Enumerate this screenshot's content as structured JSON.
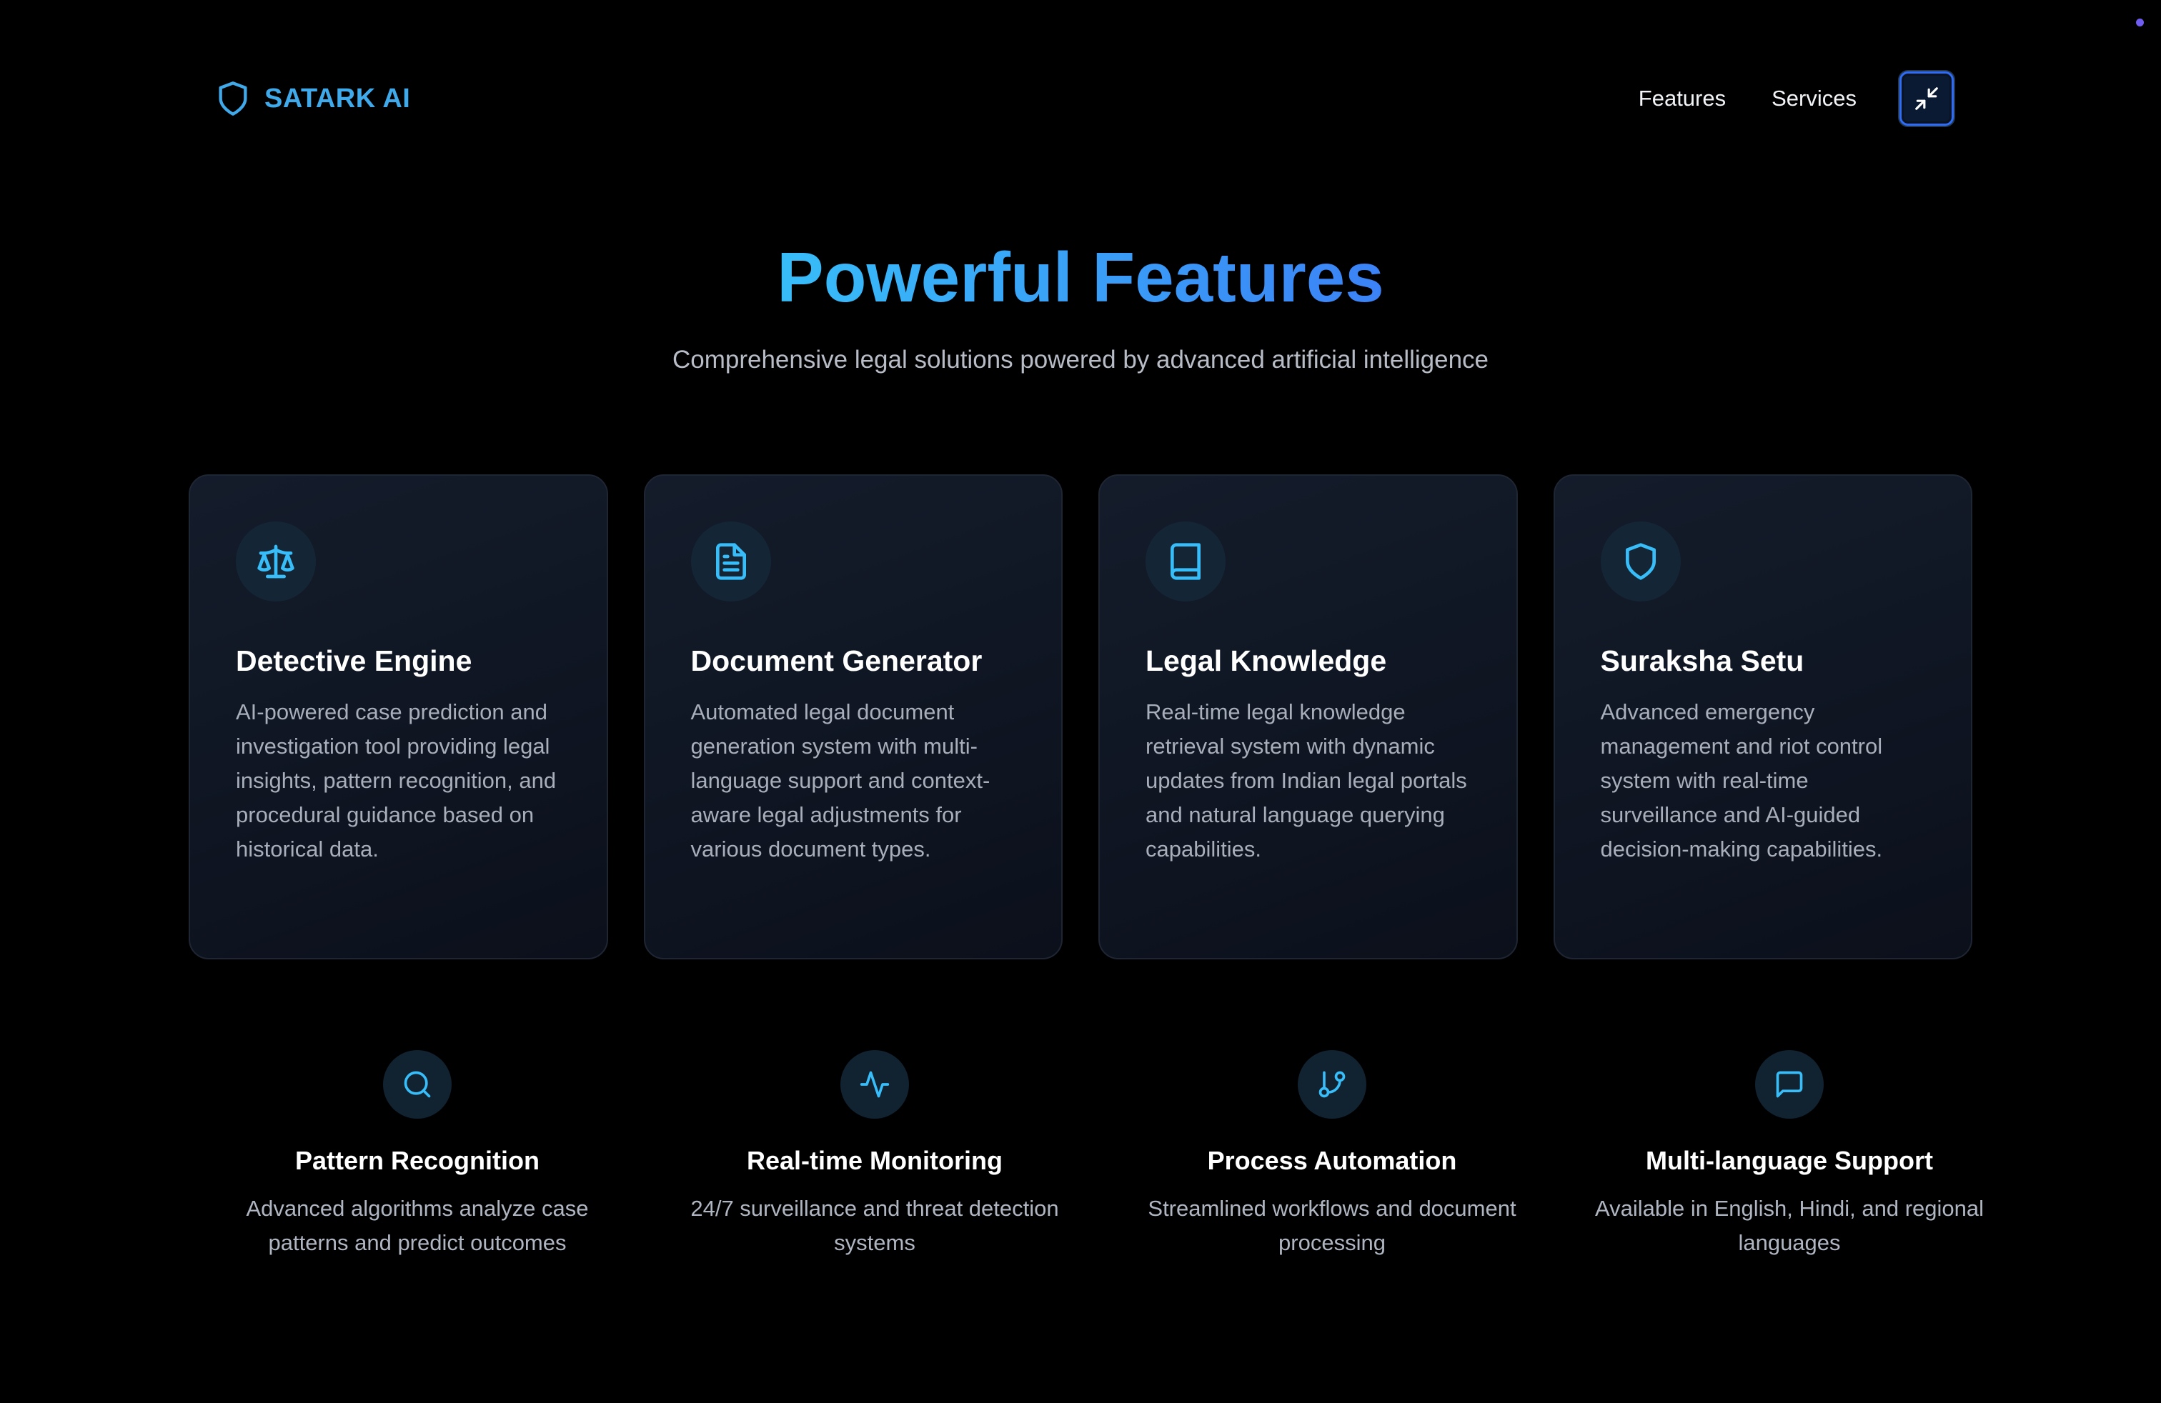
{
  "colors": {
    "background": "#000000",
    "accent": "#3fa9ea",
    "accent_gradient_start": "#38bdf8",
    "accent_gradient_end": "#3b82f6",
    "card_bg": "#0f1522",
    "card_border": "#1f2633",
    "icon_circle": "#142636"
  },
  "header": {
    "brand_icon": "shield-icon",
    "brand_name": "SATARK AI",
    "nav": [
      {
        "label": "Features"
      },
      {
        "label": "Services"
      }
    ],
    "action_icon": "minimize-icon"
  },
  "hero": {
    "title": "Powerful Features",
    "subtitle": "Comprehensive legal solutions powered by advanced artificial intelligence"
  },
  "cards": [
    {
      "icon": "scale-icon",
      "title": "Detective Engine",
      "description": "AI-powered case prediction and investigation tool providing legal insights, pattern recognition, and procedural guidance based on historical data."
    },
    {
      "icon": "document-icon",
      "title": "Document Generator",
      "description": "Automated legal document generation system with multi-language support and context-aware legal adjustments for various document types."
    },
    {
      "icon": "book-icon",
      "title": "Legal Knowledge",
      "description": "Real-time legal knowledge retrieval system with dynamic updates from Indian legal portals and natural language querying capabilities."
    },
    {
      "icon": "shield-icon",
      "title": "Suraksha Setu",
      "description": "Advanced emergency management and riot control system with real-time surveillance and AI-guided decision-making capabilities."
    }
  ],
  "features": [
    {
      "icon": "search-icon",
      "title": "Pattern Recognition",
      "description": "Advanced algorithms analyze case patterns and predict outcomes"
    },
    {
      "icon": "activity-icon",
      "title": "Real-time Monitoring",
      "description": "24/7 surveillance and threat detection systems"
    },
    {
      "icon": "git-branch-icon",
      "title": "Process Automation",
      "description": "Streamlined workflows and document processing"
    },
    {
      "icon": "message-square-icon",
      "title": "Multi-language Support",
      "description": "Available in English, Hindi, and regional languages"
    }
  ]
}
